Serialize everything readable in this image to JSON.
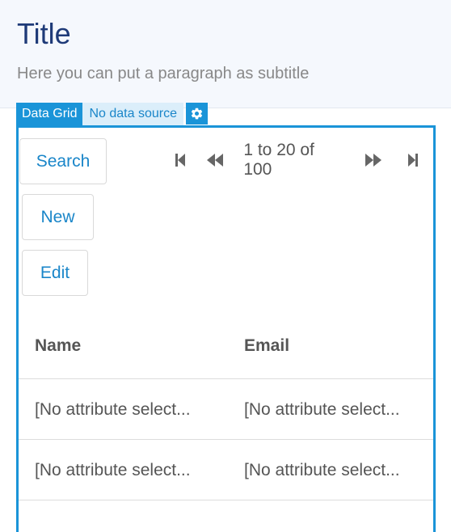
{
  "header": {
    "title": "Title",
    "subtitle": "Here you can put a paragraph as subtitle"
  },
  "widget_tabs": {
    "data_grid": "Data Grid",
    "no_data_source": "No data source",
    "settings_icon": "gear-icon"
  },
  "toolbar": {
    "search": "Search",
    "new": "New",
    "edit": "Edit"
  },
  "pagination": {
    "first_icon": "first-page-icon",
    "prev_icon": "previous-page-icon",
    "range_text": "1 to 20 of 100",
    "next_icon": "next-page-icon",
    "last_icon": "last-page-icon"
  },
  "table": {
    "columns": [
      "Name",
      "Email"
    ],
    "rows": [
      [
        "[No attribute select...",
        "[No attribute select..."
      ],
      [
        "[No attribute select...",
        "[No attribute select..."
      ]
    ]
  },
  "colors": {
    "accent": "#1a94d8",
    "title": "#1e3a78",
    "link": "#1a86c9",
    "text": "#555555",
    "header_bg": "#f5f8fd"
  }
}
